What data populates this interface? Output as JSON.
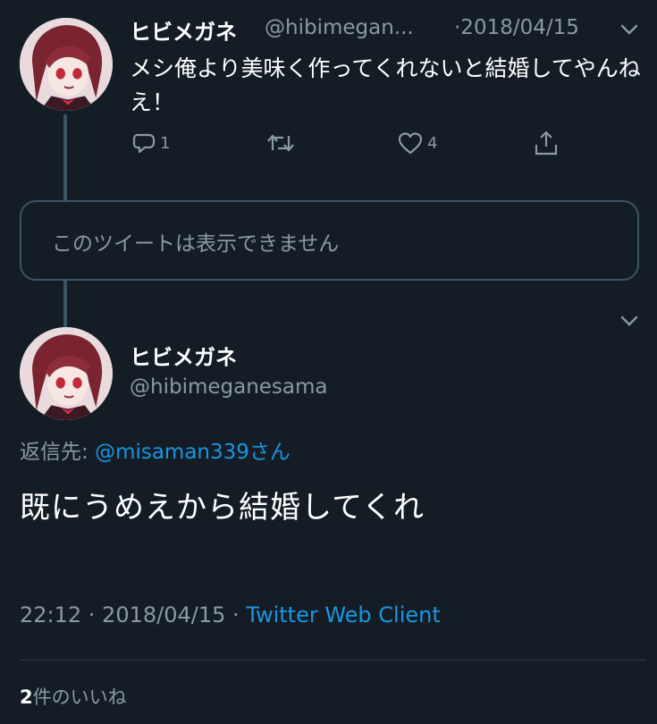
{
  "colors": {
    "background": "#141d26",
    "text_primary": "#ffffff",
    "text_secondary": "#8899a6",
    "link": "#1b95e0",
    "border": "#3d5466"
  },
  "first_tweet": {
    "name": "ヒビメガネ",
    "handle": "@hibimegan...",
    "date": "·2018/04/15",
    "text": "メシ俺より美味く作ってくれないと結婚してやんねえ！",
    "actions": {
      "reply_icon": "reply-icon",
      "reply_count": "1",
      "retweet_icon": "retweet-icon",
      "like_icon": "heart-icon",
      "like_count": "4",
      "share_icon": "share-icon"
    }
  },
  "unavailable_tweet": {
    "text": "このツイートは表示できません"
  },
  "main_tweet": {
    "name": "ヒビメガネ",
    "handle": "@hibimeganesama",
    "reply_prefix": "返信先: ",
    "reply_mention": "@misaman339さん",
    "text": "既にうめえから結婚してくれ",
    "time": "22:12 · 2018/04/15 · ",
    "client": "Twitter Web Client",
    "likes_count": "2",
    "likes_label": "件のいいね"
  }
}
